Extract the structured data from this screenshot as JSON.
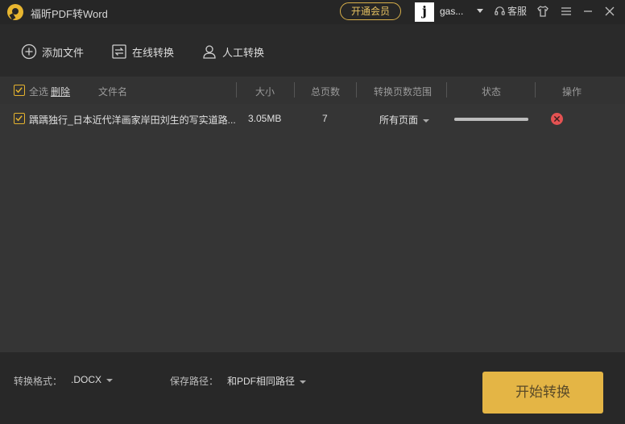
{
  "app": {
    "title": "福昕PDF转Word"
  },
  "titlebar": {
    "vip_label": "开通会员",
    "avatar_letter": "j",
    "username": "gas...",
    "service_label": "客服"
  },
  "toolbar": {
    "add_file": "添加文件",
    "online_convert": "在线转换",
    "manual_convert": "人工转换"
  },
  "table": {
    "select_all": "全选",
    "delete": "删除",
    "headers": {
      "filename": "文件名",
      "size": "大小",
      "pages": "总页数",
      "range": "转换页数范围",
      "status": "状态",
      "action": "操作"
    },
    "rows": [
      {
        "filename": "踽踽独行_日本近代洋画家岸田刘生的写实道路...",
        "size": "3.05MB",
        "pages": "7",
        "range": "所有页面",
        "progress": 1.0
      }
    ]
  },
  "footer": {
    "format_label": "转换格式：",
    "format_value": ".DOCX",
    "path_label": "保存路径：",
    "path_value": "和PDF相同路径",
    "start_button": "开始转换"
  },
  "colors": {
    "accent": "#e4b545",
    "checkbox": "#e4b22e",
    "remove": "#e45252"
  }
}
